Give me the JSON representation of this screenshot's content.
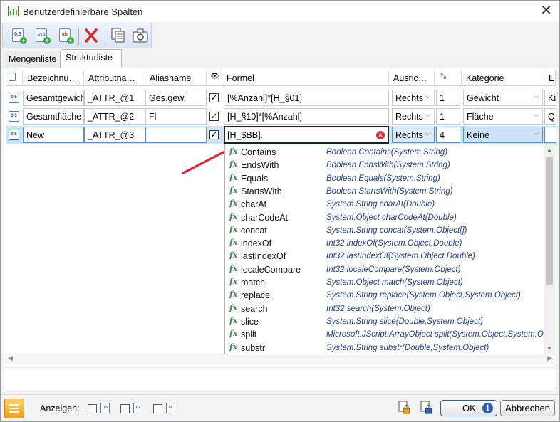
{
  "window": {
    "title": "Benutzerdefinierbare Spalten"
  },
  "tabs": [
    {
      "label": "Mengenliste"
    },
    {
      "label": "Strukturliste"
    }
  ],
  "toolbar": {
    "icon_new_label": "0.5",
    "icon_new_numeric_label": "1/2 3",
    "icon_new_text_label": "ab"
  },
  "grid": {
    "headers": [
      "Bezeichnu…",
      "Attributna…",
      "Aliasname",
      "Formel",
      "Ausric…",
      "Kategorie",
      "Ei"
    ],
    "rows": [
      {
        "bezeichnung": "Gesamtgewicht",
        "attribut": "_ATTR_@1",
        "alias": "Ges.gew.",
        "formel": "[%Anzahl]*[H_§01]",
        "ausrichtung": "Rechts",
        "nummer": "1",
        "kategorie": "Gewicht",
        "ei": "Ki"
      },
      {
        "bezeichnung": "Gesamtfläche",
        "attribut": "_ATTR_@2",
        "alias": "Fl",
        "formel": "[H_§10]*[%Anzahl]",
        "ausrichtung": "Rechts",
        "nummer": "1",
        "kategorie": "Fläche",
        "ei": "Q"
      },
      {
        "bezeichnung": "New",
        "attribut": "_ATTR_@3",
        "alias": "",
        "formel": "[H_$BB].",
        "ausrichtung": "Rechts",
        "nummer": "4",
        "kategorie": "Keine",
        "ei": ""
      }
    ]
  },
  "autocomplete": {
    "items": [
      {
        "name": "Contains",
        "signature": "Boolean Contains(System.String)"
      },
      {
        "name": "EndsWith",
        "signature": "Boolean EndsWith(System.String)"
      },
      {
        "name": "Equals",
        "signature": "Boolean Equals(System.String)"
      },
      {
        "name": "StartsWith",
        "signature": "Boolean StartsWith(System.String)"
      },
      {
        "name": "charAt",
        "signature": "System.String charAt(Double)"
      },
      {
        "name": "charCodeAt",
        "signature": "System.Object charCodeAt(Double)"
      },
      {
        "name": "concat",
        "signature": "System.String concat(System.Object[])"
      },
      {
        "name": "indexOf",
        "signature": "Int32 indexOf(System.Object,Double)"
      },
      {
        "name": "lastIndexOf",
        "signature": "Int32 lastIndexOf(System.Object,Double)"
      },
      {
        "name": "localeCompare",
        "signature": "Int32 localeCompare(System.Object)"
      },
      {
        "name": "match",
        "signature": "System.Object match(System.Object)"
      },
      {
        "name": "replace",
        "signature": "System.String replace(System.Object,System.Object)"
      },
      {
        "name": "search",
        "signature": "Int32 search(System.Object)"
      },
      {
        "name": "slice",
        "signature": "System.String slice(Double,System.Object)"
      },
      {
        "name": "split",
        "signature": "Microsoft.JScript.ArrayObject split(System.Object,System.Ob"
      },
      {
        "name": "substr",
        "signature": "System.String substr(Double,System.Object)"
      }
    ]
  },
  "footer": {
    "anzeigen_label": "Anzeigen:",
    "ok_label": "OK",
    "cancel_label": "Abbrechen"
  },
  "colors": {
    "accent": "#cfe3f8",
    "error": "#d0303a",
    "signature": "#1f3d8a",
    "fx": "#3f8a4a",
    "arrow": "#e0202a"
  }
}
